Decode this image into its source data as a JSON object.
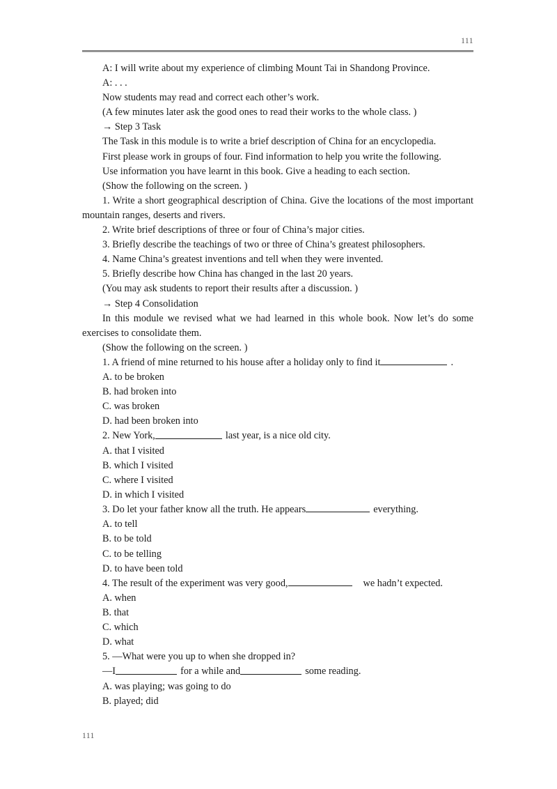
{
  "document": {
    "header": {
      "page_number": "111"
    },
    "footer": {
      "page_number": "111"
    },
    "body": {
      "lines": [
        {
          "id": "l01",
          "text": "A: I will write about my experience of climbing Mount Tai in Shandong Province."
        },
        {
          "id": "l02",
          "text": "A: . . ."
        },
        {
          "id": "l03",
          "text": "Now students may read and correct each other’s work."
        },
        {
          "id": "l04",
          "text": "(A few minutes later ask the good ones to read their works to the whole class. )"
        },
        {
          "id": "l05",
          "text": "→ Step 3 Task"
        },
        {
          "id": "l06",
          "text": "The Task in this module is to write a brief description of China for an encyclopedia."
        },
        {
          "id": "l07",
          "text": "First please work in groups of four. Find information to help you write the following."
        },
        {
          "id": "l08",
          "text": "Use information you have learnt in this book. Give a heading to each section."
        },
        {
          "id": "l09",
          "text": "(Show the following on the screen. )"
        },
        {
          "id": "l10",
          "text": "1. Write a short geographical description of China. Give the locations of the most important mountain ranges, deserts and rivers."
        },
        {
          "id": "l11",
          "text": "2. Write brief descriptions of three or four of China’s major cities."
        },
        {
          "id": "l12",
          "text": "3. Briefly describe the teachings of two or three of China’s greatest philosophers."
        },
        {
          "id": "l13",
          "text": "4. Name China’s greatest inventions and tell when they were invented."
        },
        {
          "id": "l14",
          "text": "5. Briefly describe how China has changed in the last 20 years."
        },
        {
          "id": "l15",
          "text": "(You may ask students to report their results after a discussion. )"
        },
        {
          "id": "l16",
          "text": "→ Step 4 Consolidation"
        },
        {
          "id": "l17",
          "text": "In this module we revised what we had learned in this whole book. Now let’s do some exercises to consolidate them."
        },
        {
          "id": "l18",
          "text": "(Show the following on the screen. )"
        }
      ],
      "exercises": [
        {
          "number": "1.",
          "stem_before": "1. A friend of mine returned to his house after a holiday only to find it",
          "stem_after": ".",
          "options": [
            "A. to be broken",
            "B. had broken into",
            "C. was broken",
            "D. had been broken into"
          ]
        },
        {
          "number": "2.",
          "stem_before": "2. New York,",
          "stem_after": "last year, is a nice old city.",
          "options": [
            "A. that I visited",
            "B. which I visited",
            "C. where I visited",
            "D. in which I visited"
          ]
        },
        {
          "number": "3.",
          "stem_before": "3. Do let your father know all the truth. He appears",
          "stem_after": "everything.",
          "options": [
            "A. to tell",
            "B. to be told",
            "C. to be telling",
            "D. to have been told"
          ]
        },
        {
          "number": "4.",
          "stem_before": "4. The result of the experiment was very good,",
          "stem_after": "we hadn’t expected.",
          "options": [
            "A. when",
            "B. that",
            "C. which",
            "D. what"
          ]
        },
        {
          "number": "5.",
          "question_line": "5. —What were you up to when she dropped in?",
          "answer_before": "—I",
          "answer_middle": "for a while and",
          "answer_after": "some reading.",
          "options": [
            "A. was playing; was going to do",
            "B. played; did"
          ]
        }
      ]
    }
  }
}
